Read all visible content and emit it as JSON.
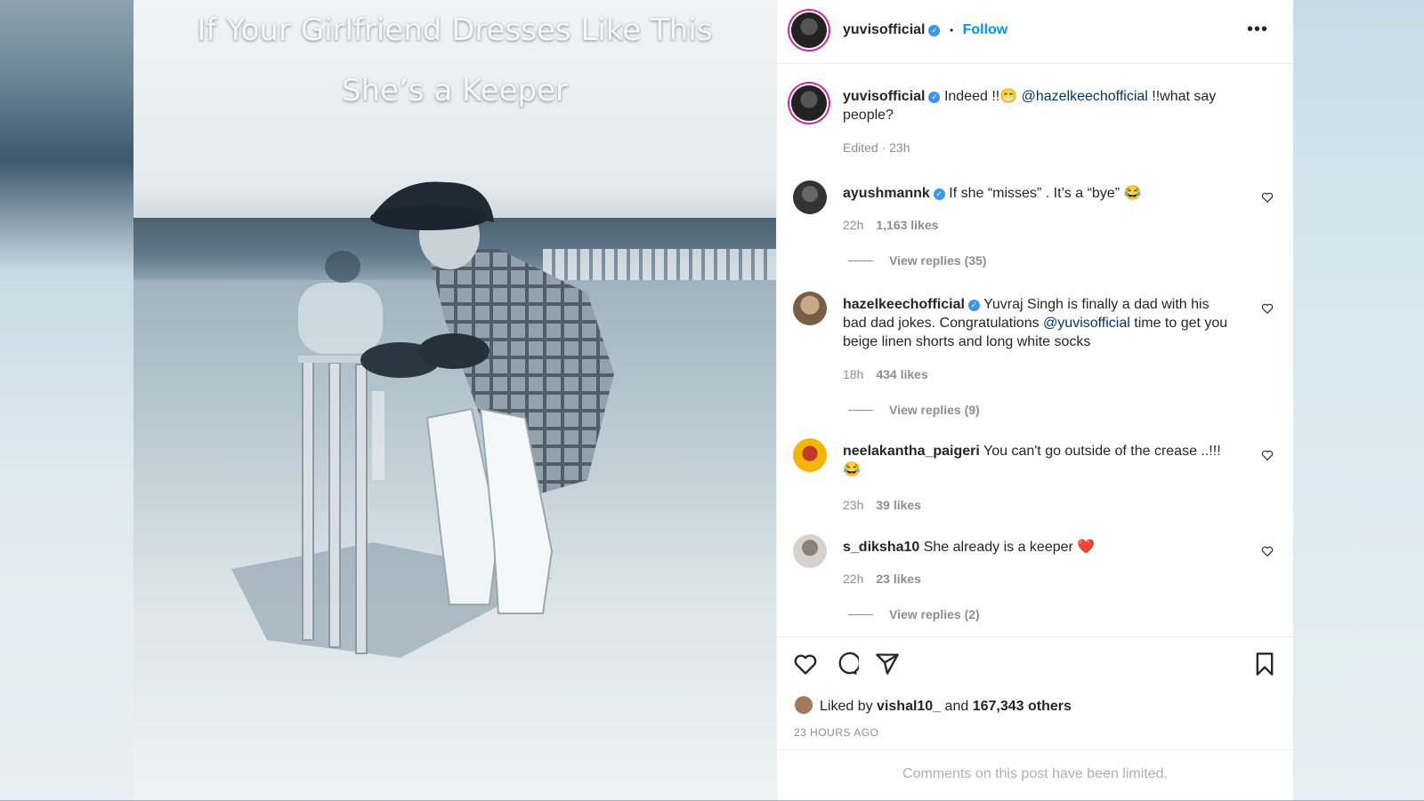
{
  "image_caption": {
    "line1": "If Your Girlfriend Dresses Like This",
    "line2": "She’s a Keeper"
  },
  "header": {
    "username": "yuvisofficial",
    "separator": "•",
    "follow_label": "Follow",
    "more_icon": "more-dots-icon"
  },
  "caption": {
    "username": "yuvisofficial",
    "text_before": "Indeed !!😁 ",
    "mention": "@hazelkeechofficial",
    "text_after": " !!what say people?",
    "meta": "Edited · 23h"
  },
  "comments": [
    {
      "username": "ayushmannk",
      "verified": true,
      "text": "If she “misses” . It’s a “bye” 😂",
      "time": "22h",
      "likes": "1,163 likes",
      "replies": "View replies (35)"
    },
    {
      "username": "hazelkeechofficial",
      "verified": true,
      "text_before": "Yuvraj Singh is finally a dad with his bad dad jokes. Congratulations ",
      "mention": "@yuvisofficial",
      "text_after": " time to get you beige linen shorts and long white socks",
      "time": "18h",
      "likes": "434 likes",
      "replies": "View replies (9)"
    },
    {
      "username": "neelakantha_paigeri",
      "verified": false,
      "text": "You can't go outside of the crease ..!!! 😂",
      "time": "23h",
      "likes": "39 likes"
    },
    {
      "username": "s_diksha10",
      "verified": false,
      "text": "She already is a keeper ❤️",
      "time": "22h",
      "likes": "23 likes",
      "replies": "View replies (2)"
    }
  ],
  "actions": {
    "icons": [
      "heart-icon",
      "comment-icon",
      "share-icon",
      "bookmark-icon"
    ],
    "liked_by_prefix": "Liked by ",
    "liked_by_user": "vishal10_",
    "liked_by_mid": " and ",
    "liked_by_others": "167,343 others",
    "time_ago": "23 HOURS AGO"
  },
  "footer": {
    "limited_text": "Comments on this post have been limited."
  },
  "colors": {
    "link_blue": "#0095f6",
    "mention_blue": "#00376b",
    "verified_blue": "#3897f0",
    "text_dark": "#262626",
    "text_muted": "#8e8e8e"
  }
}
